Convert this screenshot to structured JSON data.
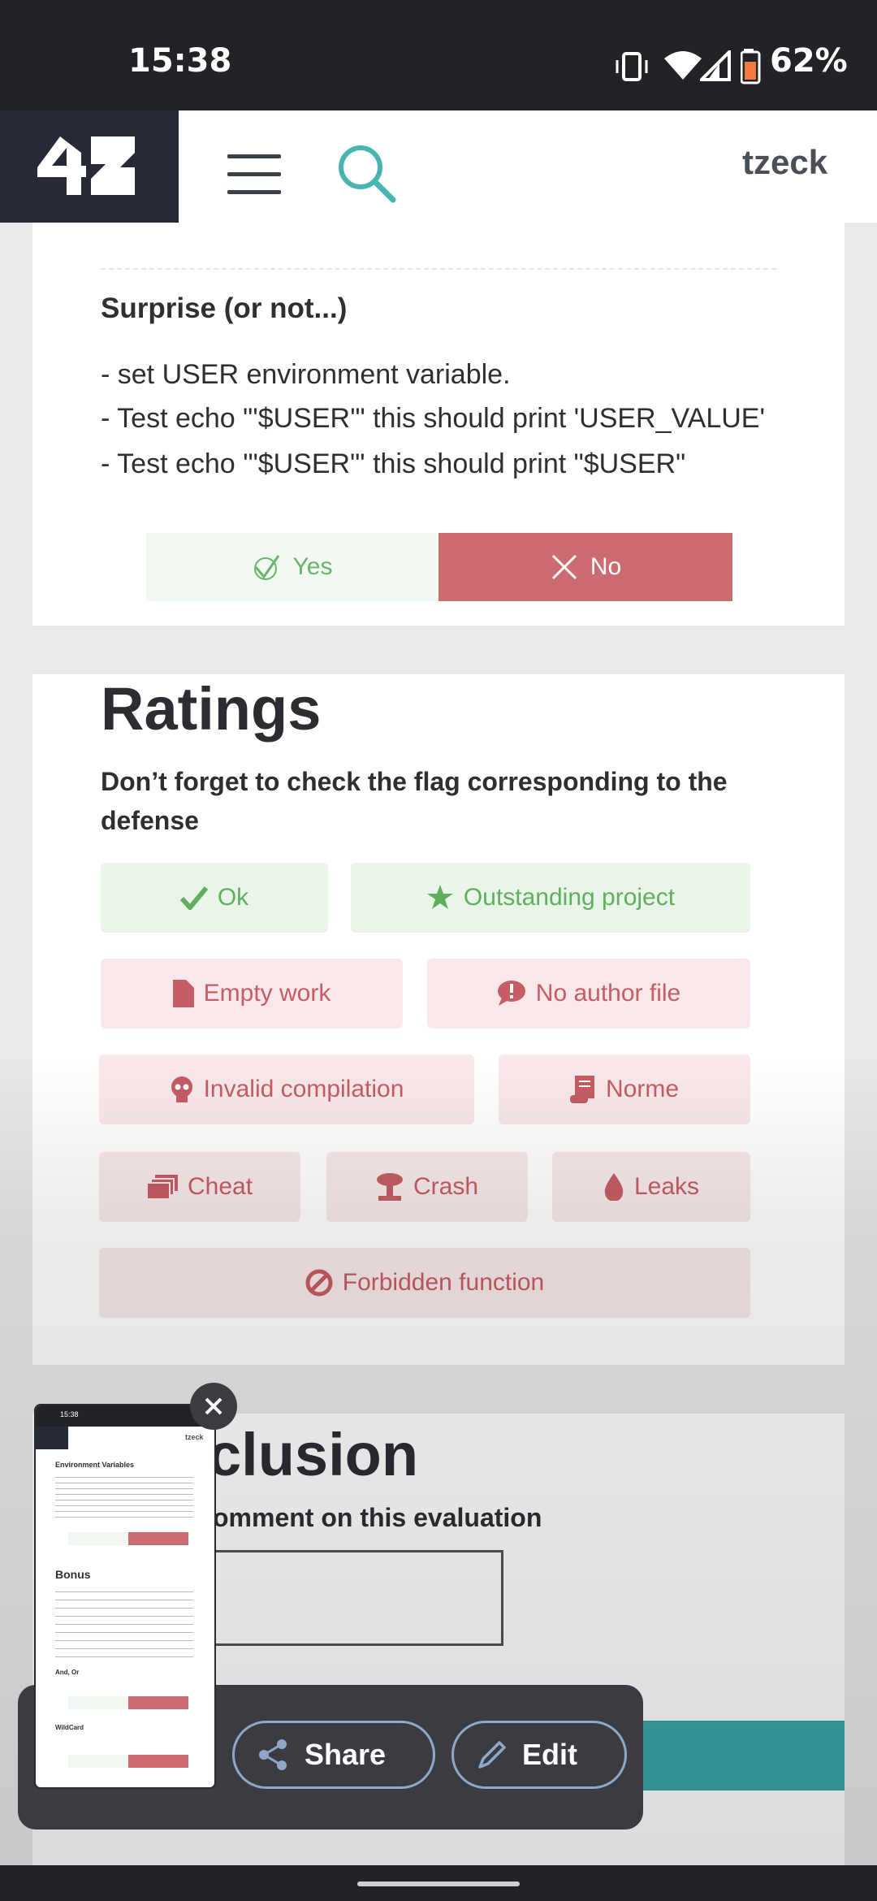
{
  "status_bar": {
    "time": "15:38",
    "battery": "62%"
  },
  "header": {
    "username": "tzeck"
  },
  "question": {
    "title": "Surprise (or not...)",
    "lines": [
      "- set USER environment variable.",
      "- Test echo \"'$USER'\" this should print 'USER_VALUE'",
      "- Test echo '\"$USER\"' this should print \"$USER\""
    ],
    "yes_label": "Yes",
    "no_label": "No"
  },
  "ratings": {
    "title": "Ratings",
    "instruction": "Don’t forget to check the flag corresponding to the defense",
    "flags": {
      "ok": "Ok",
      "outstanding": "Outstanding project",
      "empty_work": "Empty work",
      "no_author_file": "No author file",
      "invalid_compilation": "Invalid compilation",
      "norme": "Norme",
      "cheat": "Cheat",
      "crash": "Crash",
      "leaks": "Leaks",
      "forbidden_function": "Forbidden function"
    }
  },
  "conclusion": {
    "title_visible": "clusion",
    "comment_prompt_visible": "omment on this evaluation"
  },
  "screenshot_toolbar": {
    "share_label": "Share",
    "edit_label": "Edit"
  },
  "thumbnail": {
    "time": "15:38",
    "username": "tzeck",
    "section1": "Environment Variables",
    "section2": "Bonus",
    "section3": "And, Or",
    "section4": "WildCard",
    "yes": "Yes",
    "no": "No"
  },
  "colors": {
    "accent_teal": "#3aa6a6",
    "no_red": "#cc6b72",
    "yes_green": "#6ab46d",
    "brand_dark": "#262a36"
  }
}
